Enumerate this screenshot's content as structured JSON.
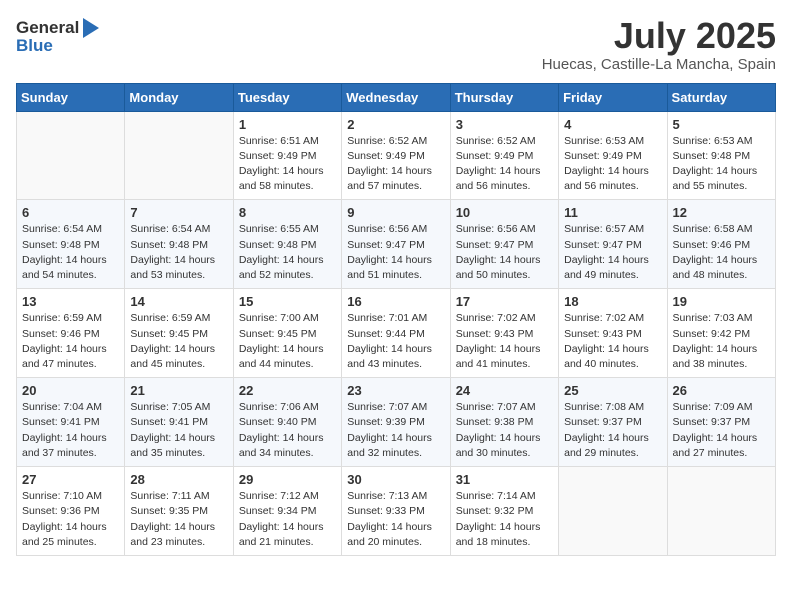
{
  "logo": {
    "general": "General",
    "blue": "Blue"
  },
  "title": {
    "month_year": "July 2025",
    "location": "Huecas, Castille-La Mancha, Spain"
  },
  "weekdays": [
    "Sunday",
    "Monday",
    "Tuesday",
    "Wednesday",
    "Thursday",
    "Friday",
    "Saturday"
  ],
  "weeks": [
    [
      {
        "day": "",
        "info": ""
      },
      {
        "day": "",
        "info": ""
      },
      {
        "day": "1",
        "info": "Sunrise: 6:51 AM\nSunset: 9:49 PM\nDaylight: 14 hours and 58 minutes."
      },
      {
        "day": "2",
        "info": "Sunrise: 6:52 AM\nSunset: 9:49 PM\nDaylight: 14 hours and 57 minutes."
      },
      {
        "day": "3",
        "info": "Sunrise: 6:52 AM\nSunset: 9:49 PM\nDaylight: 14 hours and 56 minutes."
      },
      {
        "day": "4",
        "info": "Sunrise: 6:53 AM\nSunset: 9:49 PM\nDaylight: 14 hours and 56 minutes."
      },
      {
        "day": "5",
        "info": "Sunrise: 6:53 AM\nSunset: 9:48 PM\nDaylight: 14 hours and 55 minutes."
      }
    ],
    [
      {
        "day": "6",
        "info": "Sunrise: 6:54 AM\nSunset: 9:48 PM\nDaylight: 14 hours and 54 minutes."
      },
      {
        "day": "7",
        "info": "Sunrise: 6:54 AM\nSunset: 9:48 PM\nDaylight: 14 hours and 53 minutes."
      },
      {
        "day": "8",
        "info": "Sunrise: 6:55 AM\nSunset: 9:48 PM\nDaylight: 14 hours and 52 minutes."
      },
      {
        "day": "9",
        "info": "Sunrise: 6:56 AM\nSunset: 9:47 PM\nDaylight: 14 hours and 51 minutes."
      },
      {
        "day": "10",
        "info": "Sunrise: 6:56 AM\nSunset: 9:47 PM\nDaylight: 14 hours and 50 minutes."
      },
      {
        "day": "11",
        "info": "Sunrise: 6:57 AM\nSunset: 9:47 PM\nDaylight: 14 hours and 49 minutes."
      },
      {
        "day": "12",
        "info": "Sunrise: 6:58 AM\nSunset: 9:46 PM\nDaylight: 14 hours and 48 minutes."
      }
    ],
    [
      {
        "day": "13",
        "info": "Sunrise: 6:59 AM\nSunset: 9:46 PM\nDaylight: 14 hours and 47 minutes."
      },
      {
        "day": "14",
        "info": "Sunrise: 6:59 AM\nSunset: 9:45 PM\nDaylight: 14 hours and 45 minutes."
      },
      {
        "day": "15",
        "info": "Sunrise: 7:00 AM\nSunset: 9:45 PM\nDaylight: 14 hours and 44 minutes."
      },
      {
        "day": "16",
        "info": "Sunrise: 7:01 AM\nSunset: 9:44 PM\nDaylight: 14 hours and 43 minutes."
      },
      {
        "day": "17",
        "info": "Sunrise: 7:02 AM\nSunset: 9:43 PM\nDaylight: 14 hours and 41 minutes."
      },
      {
        "day": "18",
        "info": "Sunrise: 7:02 AM\nSunset: 9:43 PM\nDaylight: 14 hours and 40 minutes."
      },
      {
        "day": "19",
        "info": "Sunrise: 7:03 AM\nSunset: 9:42 PM\nDaylight: 14 hours and 38 minutes."
      }
    ],
    [
      {
        "day": "20",
        "info": "Sunrise: 7:04 AM\nSunset: 9:41 PM\nDaylight: 14 hours and 37 minutes."
      },
      {
        "day": "21",
        "info": "Sunrise: 7:05 AM\nSunset: 9:41 PM\nDaylight: 14 hours and 35 minutes."
      },
      {
        "day": "22",
        "info": "Sunrise: 7:06 AM\nSunset: 9:40 PM\nDaylight: 14 hours and 34 minutes."
      },
      {
        "day": "23",
        "info": "Sunrise: 7:07 AM\nSunset: 9:39 PM\nDaylight: 14 hours and 32 minutes."
      },
      {
        "day": "24",
        "info": "Sunrise: 7:07 AM\nSunset: 9:38 PM\nDaylight: 14 hours and 30 minutes."
      },
      {
        "day": "25",
        "info": "Sunrise: 7:08 AM\nSunset: 9:37 PM\nDaylight: 14 hours and 29 minutes."
      },
      {
        "day": "26",
        "info": "Sunrise: 7:09 AM\nSunset: 9:37 PM\nDaylight: 14 hours and 27 minutes."
      }
    ],
    [
      {
        "day": "27",
        "info": "Sunrise: 7:10 AM\nSunset: 9:36 PM\nDaylight: 14 hours and 25 minutes."
      },
      {
        "day": "28",
        "info": "Sunrise: 7:11 AM\nSunset: 9:35 PM\nDaylight: 14 hours and 23 minutes."
      },
      {
        "day": "29",
        "info": "Sunrise: 7:12 AM\nSunset: 9:34 PM\nDaylight: 14 hours and 21 minutes."
      },
      {
        "day": "30",
        "info": "Sunrise: 7:13 AM\nSunset: 9:33 PM\nDaylight: 14 hours and 20 minutes."
      },
      {
        "day": "31",
        "info": "Sunrise: 7:14 AM\nSunset: 9:32 PM\nDaylight: 14 hours and 18 minutes."
      },
      {
        "day": "",
        "info": ""
      },
      {
        "day": "",
        "info": ""
      }
    ]
  ]
}
